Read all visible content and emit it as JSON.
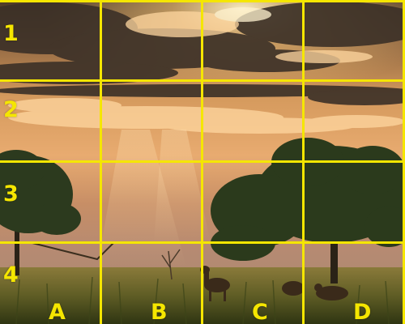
{
  "image": {
    "description_colors": {
      "sky_top": "#3a2d20",
      "sky_glow": "#f2b266",
      "haze": "#d99a63",
      "ground": "#5b5a26",
      "grid": "#f5e600"
    }
  },
  "grid": {
    "columns": [
      "A",
      "B",
      "C",
      "D"
    ],
    "rows": [
      "1",
      "2",
      "3",
      "4"
    ]
  }
}
